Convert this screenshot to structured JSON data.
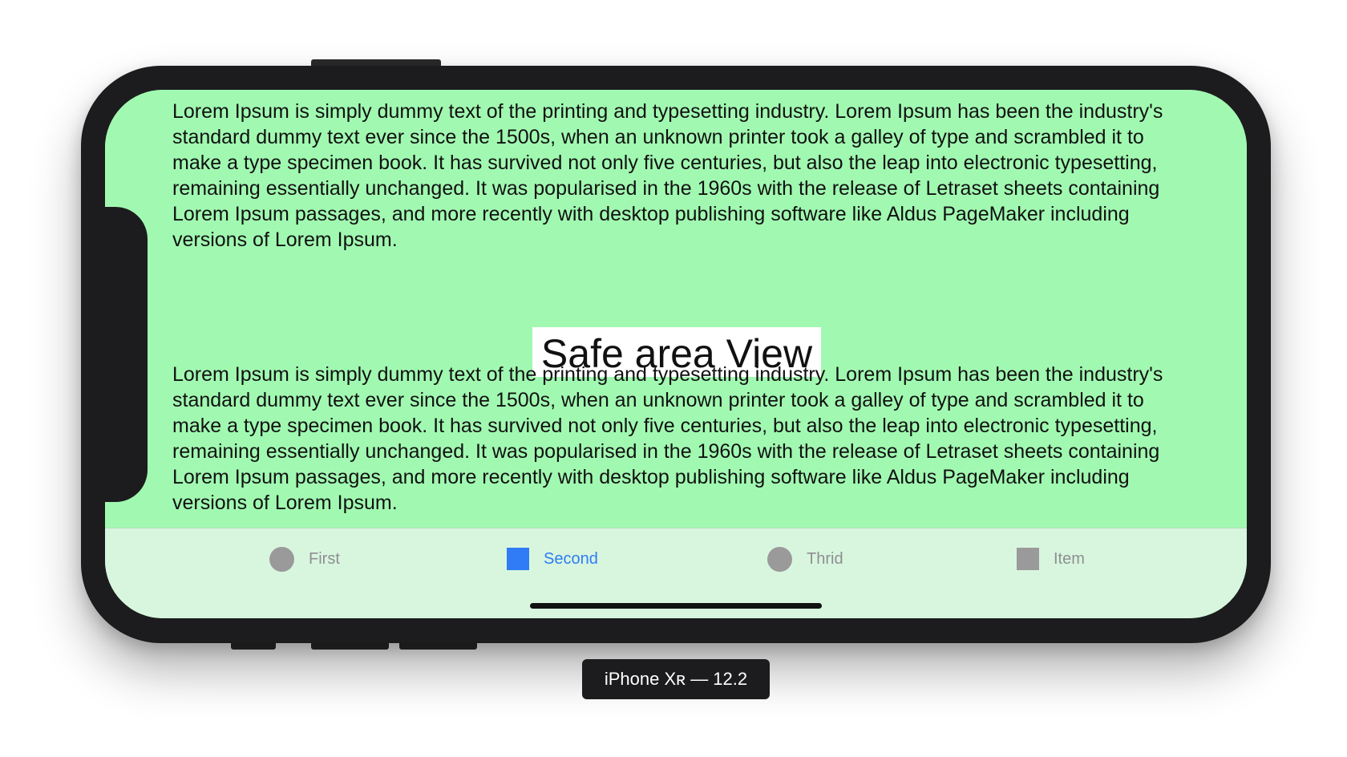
{
  "screen": {
    "paragraphs": [
      "Lorem Ipsum is simply dummy text of the printing and typesetting industry. Lorem Ipsum has been the industry's standard dummy text ever since the 1500s, when an unknown printer took a galley of type and scrambled it to make a type specimen book. It has survived not only five centuries, but also the leap into electronic typesetting, remaining essentially unchanged. It was popularised in the 1960s with the release of Letraset sheets containing Lorem Ipsum passages, and more recently with desktop publishing software like Aldus PageMaker including versions of Lorem Ipsum.",
      "Lorem Ipsum is simply dummy text of the printing and typesetting industry. Lorem Ipsum has been the industry's standard dummy text ever since the 1500s, when an unknown printer took a galley of type and scrambled it to make a type specimen book. It has survived not only five centuries, but also the leap into electronic typesetting, remaining essentially unchanged. It was popularised in the 1960s with the release of Letraset sheets containing Lorem Ipsum passages, and more recently with desktop publishing software like Aldus PageMaker including versions of Lorem Ipsum."
    ],
    "safe_area_label": "Safe area View",
    "background_color": "#a1f9b1"
  },
  "tabbar": {
    "background_color": "#d8f6de",
    "active_color": "#2f7cf6",
    "inactive_color": "#8e8e93",
    "tabs": [
      {
        "label": "First",
        "icon": "circle-icon",
        "active": false
      },
      {
        "label": "Second",
        "icon": "square-icon",
        "active": true
      },
      {
        "label": "Thrid",
        "icon": "circle-icon",
        "active": false
      },
      {
        "label": "Item",
        "icon": "square-icon",
        "active": false
      }
    ]
  },
  "device": {
    "label": "iPhone Xʀ — 12.2"
  }
}
